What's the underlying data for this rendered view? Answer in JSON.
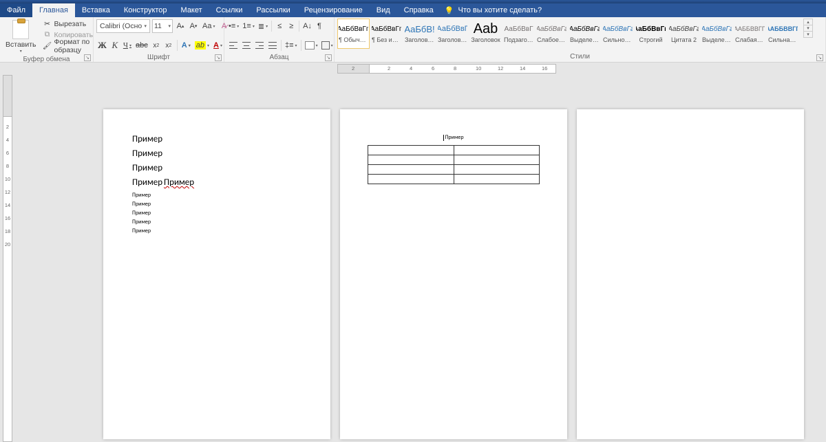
{
  "tabs": {
    "file": "Файл",
    "home": "Главная",
    "insert": "Вставка",
    "design": "Конструктор",
    "layout": "Макет",
    "references": "Ссылки",
    "mailings": "Рассылки",
    "review": "Рецензирование",
    "view": "Вид",
    "help": "Справка",
    "tell_me": "Что вы хотите сделать?"
  },
  "clipboard": {
    "paste": "Вставить",
    "cut": "Вырезать",
    "copy": "Копировать",
    "format_painter": "Формат по образцу",
    "label": "Буфер обмена"
  },
  "font": {
    "name": "Calibri (Осно",
    "size": "11",
    "label": "Шрифт"
  },
  "paragraph": {
    "label": "Абзац"
  },
  "styles": {
    "label": "Стили",
    "items": [
      {
        "preview": "АаБбВвГг,",
        "name": "¶ Обычный",
        "cls": "p-normal"
      },
      {
        "preview": "АаБбВвГг,",
        "name": "¶ Без инте...",
        "cls": "p-normal"
      },
      {
        "preview": "АаБбВ!",
        "name": "Заголово...",
        "cls": "p-h1"
      },
      {
        "preview": "АаБбВвГ",
        "name": "Заголово...",
        "cls": "p-h2"
      },
      {
        "preview": "Aab",
        "name": "Заголовок",
        "cls": "p-title"
      },
      {
        "preview": "АаБбВвГ",
        "name": "Подзагол...",
        "cls": "p-sub"
      },
      {
        "preview": "АаБбВвГг",
        "name": "Слабое в...",
        "cls": "p-subtle"
      },
      {
        "preview": "АаБбВвГг",
        "name": "Выделение",
        "cls": "p-emph"
      },
      {
        "preview": "АаБбВвГг",
        "name": "Сильное...",
        "cls": "p-intense"
      },
      {
        "preview": "АаБбВвГг,",
        "name": "Строгий",
        "cls": "p-strong"
      },
      {
        "preview": "АаБбВвГг",
        "name": "Цитата 2",
        "cls": "p-quote"
      },
      {
        "preview": "АаБбВвГг",
        "name": "Выделенн...",
        "cls": "p-iq"
      },
      {
        "preview": "ААББВВГГ,",
        "name": "Слабая сс...",
        "cls": "p-caps1"
      },
      {
        "preview": "ААББВВГГ,",
        "name": "Сильная...",
        "cls": "p-caps2"
      }
    ]
  },
  "ruler": {
    "marks": [
      "2",
      "2",
      "4",
      "6",
      "8",
      "10",
      "12",
      "14",
      "16"
    ]
  },
  "document": {
    "page1": {
      "big": [
        "Пример",
        "Пример",
        "Пример"
      ],
      "big_with_err": {
        "a": "Пример",
        "b": "Пример"
      },
      "small": [
        "Пример",
        "Пример",
        "Пример",
        "Пример",
        "Пример"
      ]
    },
    "page2": {
      "caption": "Пример",
      "rows": 4,
      "cols": 2
    }
  }
}
